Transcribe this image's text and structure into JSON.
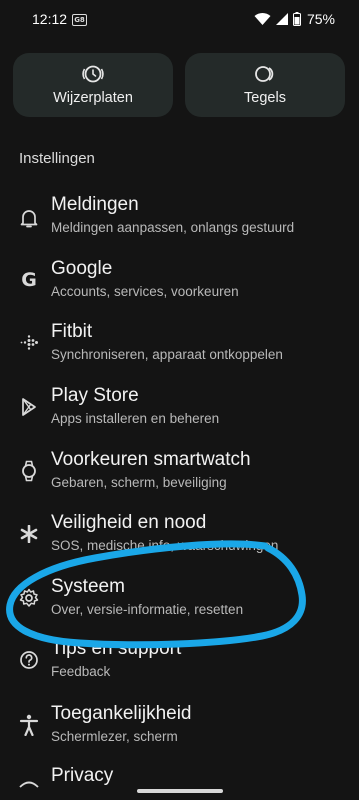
{
  "status_bar": {
    "time": "12:12",
    "notification_badge": "G8",
    "battery": "75%"
  },
  "cards": [
    {
      "label": "Wijzerplaten",
      "icon": "watch-faces-icon"
    },
    {
      "label": "Tegels",
      "icon": "tiles-icon"
    }
  ],
  "section_title": "Instellingen",
  "items": [
    {
      "title": "Meldingen",
      "subtitle": "Meldingen aanpassen, onlangs gestuurd",
      "icon": "bell-icon"
    },
    {
      "title": "Google",
      "subtitle": "Accounts, services, voorkeuren",
      "icon": "google-icon"
    },
    {
      "title": "Fitbit",
      "subtitle": "Synchroniseren, apparaat ontkoppelen",
      "icon": "fitbit-icon"
    },
    {
      "title": "Play Store",
      "subtitle": "Apps installeren en beheren",
      "icon": "play-store-icon"
    },
    {
      "title": "Voorkeuren smartwatch",
      "subtitle": "Gebaren, scherm, beveiliging",
      "icon": "watch-icon"
    },
    {
      "title": "Veiligheid en nood",
      "subtitle": "SOS, medische info, waarschuwingen",
      "icon": "asterisk-icon"
    },
    {
      "title": "Systeem",
      "subtitle": "Over, versie-informatie, resetten",
      "icon": "gear-icon"
    },
    {
      "title": "Tips en support",
      "subtitle": "Feedback",
      "icon": "help-icon"
    },
    {
      "title": "Toegankelijkheid",
      "subtitle": "Schermlezer, scherm",
      "icon": "accessibility-icon"
    },
    {
      "title": "Privacy",
      "subtitle": "",
      "icon": "privacy-icon"
    }
  ],
  "colors": {
    "annotation": "#1aa7e8",
    "card_bg": "#242a29",
    "background": "#141414"
  }
}
